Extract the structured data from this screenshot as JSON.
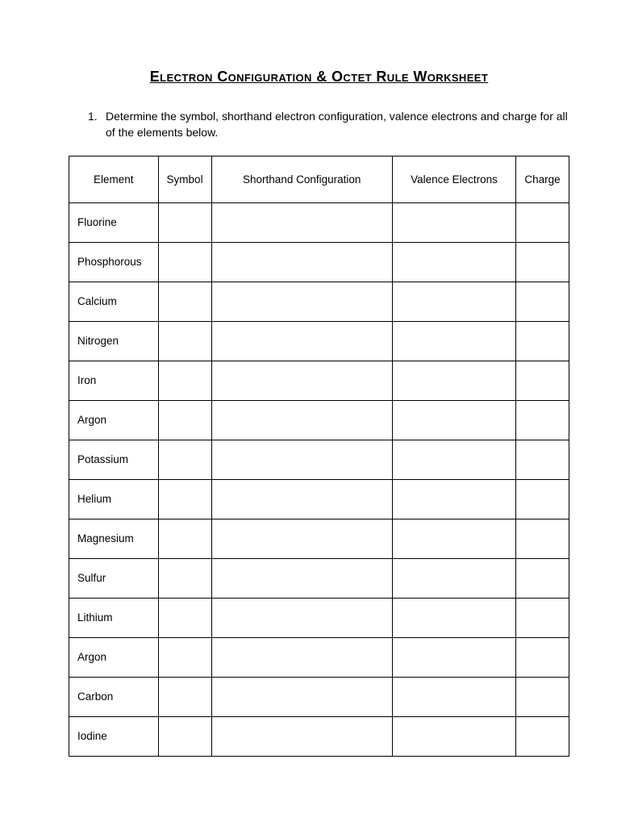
{
  "title": "Electron Configuration & Octet Rule Worksheet",
  "question": {
    "number": "1.",
    "text": "Determine the symbol, shorthand electron configuration, valence electrons and charge for all of the elements below."
  },
  "table": {
    "headers": {
      "element": "Element",
      "symbol": "Symbol",
      "config": "Shorthand Configuration",
      "valence": "Valence Electrons",
      "charge": "Charge"
    },
    "rows": [
      {
        "element": "Fluorine",
        "symbol": "",
        "config": "",
        "valence": "",
        "charge": ""
      },
      {
        "element": "Phosphorous",
        "symbol": "",
        "config": "",
        "valence": "",
        "charge": ""
      },
      {
        "element": "Calcium",
        "symbol": "",
        "config": "",
        "valence": "",
        "charge": ""
      },
      {
        "element": "Nitrogen",
        "symbol": "",
        "config": "",
        "valence": "",
        "charge": ""
      },
      {
        "element": "Iron",
        "symbol": "",
        "config": "",
        "valence": "",
        "charge": ""
      },
      {
        "element": "Argon",
        "symbol": "",
        "config": "",
        "valence": "",
        "charge": ""
      },
      {
        "element": "Potassium",
        "symbol": "",
        "config": "",
        "valence": "",
        "charge": ""
      },
      {
        "element": "Helium",
        "symbol": "",
        "config": "",
        "valence": "",
        "charge": ""
      },
      {
        "element": "Magnesium",
        "symbol": "",
        "config": "",
        "valence": "",
        "charge": ""
      },
      {
        "element": "Sulfur",
        "symbol": "",
        "config": "",
        "valence": "",
        "charge": ""
      },
      {
        "element": "Lithium",
        "symbol": "",
        "config": "",
        "valence": "",
        "charge": ""
      },
      {
        "element": "Argon",
        "symbol": "",
        "config": "",
        "valence": "",
        "charge": ""
      },
      {
        "element": "Carbon",
        "symbol": "",
        "config": "",
        "valence": "",
        "charge": ""
      },
      {
        "element": "Iodine",
        "symbol": "",
        "config": "",
        "valence": "",
        "charge": ""
      }
    ]
  }
}
